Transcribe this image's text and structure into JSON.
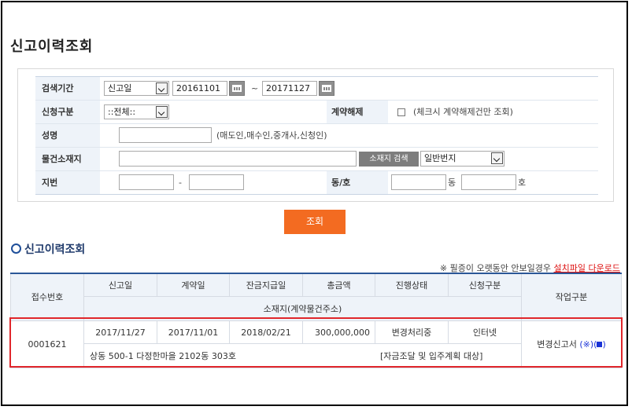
{
  "page_title": "신고이력조회",
  "search": {
    "period_label": "검색기간",
    "period_type": "신고일",
    "date_from": "20161101",
    "date_sep": "~",
    "date_to": "20171127",
    "apply_label": "신청구분",
    "apply_value": "::전체::",
    "cancel_label": "계약해제",
    "cancel_hint": "(체크시 계약해제건만 조회)",
    "name_label": "성명",
    "name_value": "",
    "name_hint": "(매도인,매수인,중개사,신청인)",
    "location_label": "물건소재지",
    "location_value": "",
    "addr_search_label": "소재지 검색",
    "lot_type": "일반번지",
    "lot_label": "지번",
    "lot_dash": "-",
    "dongho_label": "동/호",
    "dong_suffix": "동",
    "ho_suffix": "호",
    "submit_label": "조회"
  },
  "result": {
    "section_title": "신고이력조회",
    "notice_text": "※ 필증이 오랫동안 안보일경우 ",
    "notice_link": "설치파일 다운로드",
    "headers": {
      "receipt_no": "접수번호",
      "report_date": "신고일",
      "contract_date": "계약일",
      "balance_date": "잔금지급일",
      "total": "총금액",
      "status": "진행상태",
      "apply_type": "신청구분",
      "address": "소재지(계약물건주소)",
      "work_type": "작업구분"
    },
    "rows": [
      {
        "receipt_no": "0001621",
        "report_date": "2017/11/27",
        "contract_date": "2017/11/01",
        "balance_date": "2018/02/21",
        "total": "300,000,000",
        "status": "변경처리중",
        "apply_type": "인터넷",
        "address": "상동 500-1 다정한마을 2102동 303호",
        "note": "[자금조달 및 입주계획 대상]",
        "work_label": "변경신고서",
        "work_symbol_open": "(",
        "work_symbol_mark": "※",
        "work_symbol_close": ")("
      }
    ]
  },
  "colors": {
    "accent": "#f36b21",
    "header_bg": "#eef3f9",
    "highlight": "#e0262b",
    "link_red": "#dd1111"
  }
}
